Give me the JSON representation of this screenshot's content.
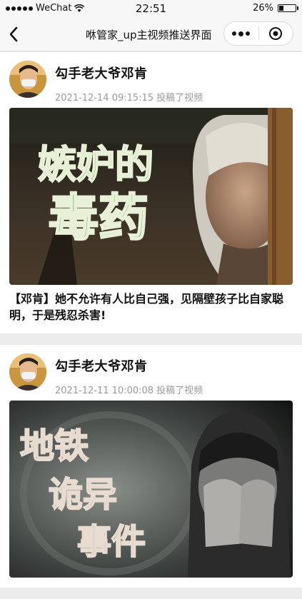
{
  "status_bar": {
    "carrier": "WeChat",
    "time": "22:51",
    "battery_text": "26%",
    "battery_level": 0.26
  },
  "nav": {
    "title": "咻管家_up主视频推送界面",
    "back_icon": "chevron-left-icon",
    "more_icon": "more-dots-icon",
    "close_icon": "target-close-icon"
  },
  "posts": [
    {
      "author": "勾手老大爷邓肯",
      "timestamp": "2021-12-14 09:15:15",
      "action": "投稿了视频",
      "cover_caption_line1": "嫉妒的",
      "cover_caption_line2": "毒药",
      "title": "【邓肯】她不允许有人比自己强，见隔壁孩子比自家聪明，于是残忍杀害!"
    },
    {
      "author": "勾手老大爷邓肯",
      "timestamp": "2021-12-11 10:00:08",
      "action": "投稿了视频",
      "cover_caption_line1": "地铁",
      "cover_caption_line2": "诡异",
      "cover_caption_line3": "事件"
    }
  ],
  "colors": {
    "caption_green": "#5fa86a",
    "caption_red": "#b0302a",
    "meta_gray": "#9a9a9a"
  }
}
